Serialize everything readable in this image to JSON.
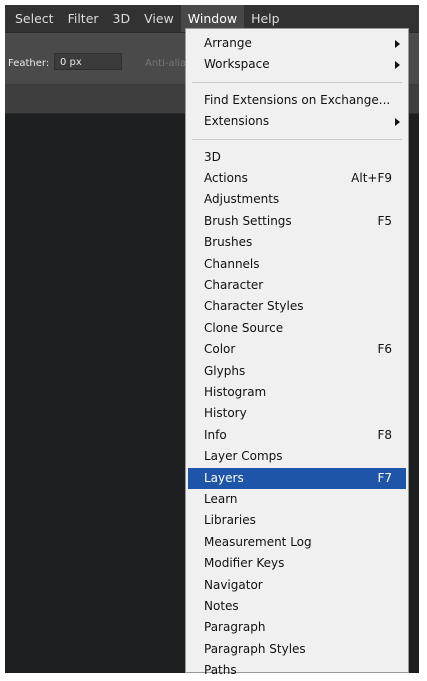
{
  "menubar": {
    "items": [
      "Select",
      "Filter",
      "3D",
      "View",
      "Window",
      "Help"
    ],
    "active": "Window"
  },
  "options": {
    "feather_label": "Feather:",
    "feather_value": "0 px",
    "antialias_label": "Anti-alias"
  },
  "window_menu": {
    "group1": [
      {
        "label": "Arrange",
        "submenu": true
      },
      {
        "label": "Workspace",
        "submenu": true
      }
    ],
    "group2": [
      {
        "label": "Find Extensions on Exchange..."
      },
      {
        "label": "Extensions",
        "submenu": true
      }
    ],
    "group3": [
      {
        "label": "3D",
        "shortcut": ""
      },
      {
        "label": "Actions",
        "shortcut": "Alt+F9"
      },
      {
        "label": "Adjustments",
        "shortcut": ""
      },
      {
        "label": "Brush Settings",
        "shortcut": "F5"
      },
      {
        "label": "Brushes",
        "shortcut": ""
      },
      {
        "label": "Channels",
        "shortcut": ""
      },
      {
        "label": "Character",
        "shortcut": ""
      },
      {
        "label": "Character Styles",
        "shortcut": ""
      },
      {
        "label": "Clone Source",
        "shortcut": ""
      },
      {
        "label": "Color",
        "shortcut": "F6"
      },
      {
        "label": "Glyphs",
        "shortcut": ""
      },
      {
        "label": "Histogram",
        "shortcut": ""
      },
      {
        "label": "History",
        "shortcut": ""
      },
      {
        "label": "Info",
        "shortcut": "F8"
      },
      {
        "label": "Layer Comps",
        "shortcut": ""
      },
      {
        "label": "Layers",
        "shortcut": "F7",
        "highlighted": true
      },
      {
        "label": "Learn",
        "shortcut": ""
      },
      {
        "label": "Libraries",
        "shortcut": ""
      },
      {
        "label": "Measurement Log",
        "shortcut": ""
      },
      {
        "label": "Modifier Keys",
        "shortcut": ""
      },
      {
        "label": "Navigator",
        "shortcut": ""
      },
      {
        "label": "Notes",
        "shortcut": ""
      },
      {
        "label": "Paragraph",
        "shortcut": ""
      },
      {
        "label": "Paragraph Styles",
        "shortcut": ""
      },
      {
        "label": "Paths",
        "shortcut": ""
      }
    ]
  },
  "colors": {
    "highlight": "#1e55a8",
    "menu_bg": "#f0f0f0",
    "menubar_bg": "#323232"
  }
}
